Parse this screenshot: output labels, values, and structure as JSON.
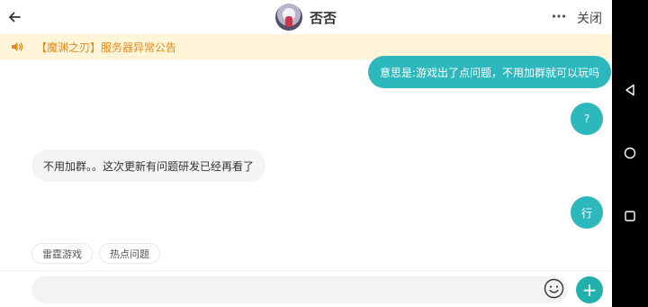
{
  "navbar": {
    "back_icon": "arrow-left-icon",
    "title": "否否",
    "more_icon": "more-dots-icon",
    "close_label": "关闭"
  },
  "notice": {
    "icon": "speaker-icon",
    "text": "【魔渊之刃】服务器异常公告"
  },
  "messages": [
    {
      "direction": "outgoing",
      "text": "意思是:游戏出了点问题，不用加群就可以玩吗"
    },
    {
      "direction": "outgoing",
      "text": "?"
    },
    {
      "direction": "incoming",
      "text": "不用加群。。这次更新有问题研发已经再看了"
    },
    {
      "direction": "outgoing",
      "text": "行"
    }
  ],
  "quick_replies": [
    {
      "label": "雷霆游戏"
    },
    {
      "label": "热点问题"
    }
  ],
  "input": {
    "value": "",
    "placeholder": "",
    "emoji_icon": "emoji-smile-icon",
    "plus_icon": "plus-icon",
    "plus_glyph": "+"
  },
  "system_nav": {
    "back_icon": "triangle-back-icon",
    "home_icon": "circle-home-icon",
    "recents_icon": "square-recents-icon"
  },
  "colors": {
    "accent": "#2db8bd",
    "notice_bg": "#fff5d9",
    "notice_text": "#e38a1c",
    "incoming_bubble": "#f2f4f6"
  }
}
